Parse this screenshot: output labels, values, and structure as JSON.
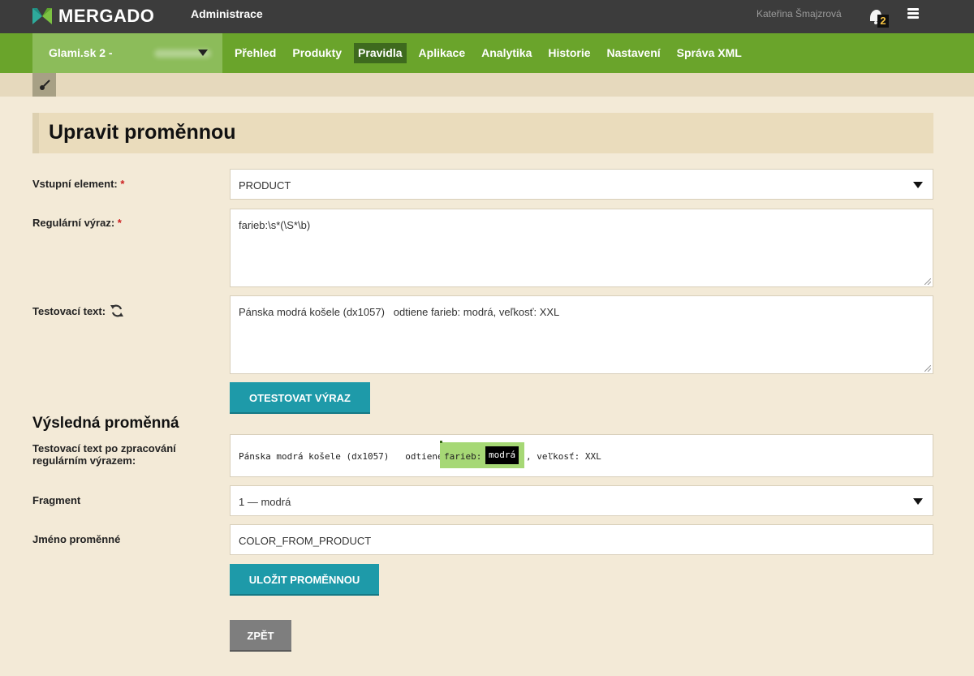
{
  "topbar": {
    "brand": "MERGADO",
    "section": "Administrace",
    "user": "Kateřina Šmajzrová",
    "notifications_count": "2"
  },
  "nav": {
    "shop": "Glami.sk 2 -",
    "items": [
      "Přehled",
      "Produkty",
      "Pravidla",
      "Aplikace",
      "Analytika",
      "Historie",
      "Nastavení",
      "Správa XML"
    ],
    "active": "Pravidla"
  },
  "page": {
    "title": "Upravit proměnnou"
  },
  "form": {
    "input_element_label": "Vstupní element:",
    "input_element_value": "PRODUCT",
    "regex_label": "Regulární výraz:",
    "regex_value": "farieb:\\s*(\\S*\\b)",
    "test_text_label": "Testovací text:",
    "test_text_value": "Pánska modrá košele (dx1057)   odtiene farieb: modrá, veľkosť: XXL",
    "required_mark": "*",
    "test_button": "OTESTOVAT VÝRAZ"
  },
  "result": {
    "section_title": "Výsledná proměnná",
    "processed_label": "Testovací text po zpracování regulárním výrazem:",
    "before": "Pánska modrá košele (dx1057)   odtiene",
    "match_prefix": "farieb: ",
    "group": "modrá",
    "after": ", veľkosť: XXL",
    "fragment_label": "Fragment",
    "fragment_value": "1 — modrá",
    "name_label": "Jméno proměnné",
    "name_value": "COLOR_FROM_PRODUCT",
    "save_button": "ULOŽIT PROMĚNNOU",
    "back_button": "ZPĚT"
  },
  "colors": {
    "topbar": "#3c3c3c",
    "nav_green": "#6aa42b",
    "accent_teal": "#1e9aa9",
    "match_highlight": "#a6d875"
  }
}
